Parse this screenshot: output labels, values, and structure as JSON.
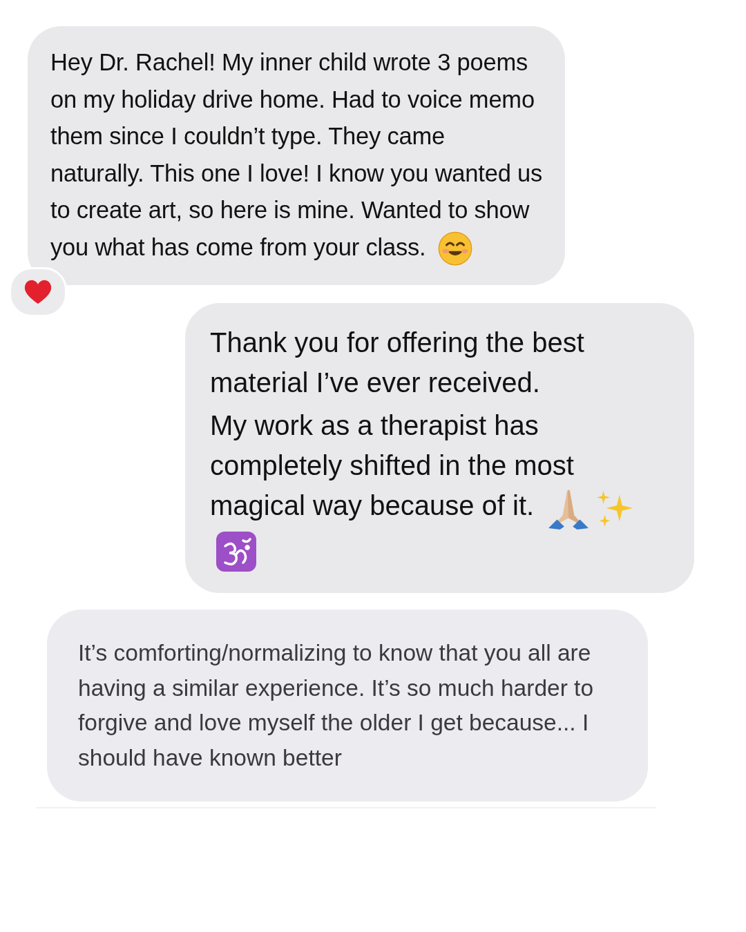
{
  "messages": [
    {
      "paragraphs": [
        "Hey Dr. Rachel! My inner child wrote 3 poems on my holiday drive home. Had to voice memo them since I couldn’t type. They came naturally. This one I love! I know you wanted us to create art, so here is mine. Wanted to show you what has come from your class."
      ],
      "icons": [
        {
          "kind": "smile"
        }
      ],
      "reaction": true
    },
    {
      "paragraphs": [
        "Thank you for offering the best material I’ve ever received.",
        "My work as a therapist has completely shifted in the most magical way because of it."
      ],
      "icons": [
        {
          "kind": "hands"
        },
        {
          "kind": "sparkles"
        },
        {
          "kind": "om"
        }
      ]
    },
    {
      "paragraphs": [
        "It’s comforting/normalizing to know that you all are having a similar experience. It’s so much harder to forgive and love myself the older I get because... I should have known better"
      ]
    }
  ]
}
